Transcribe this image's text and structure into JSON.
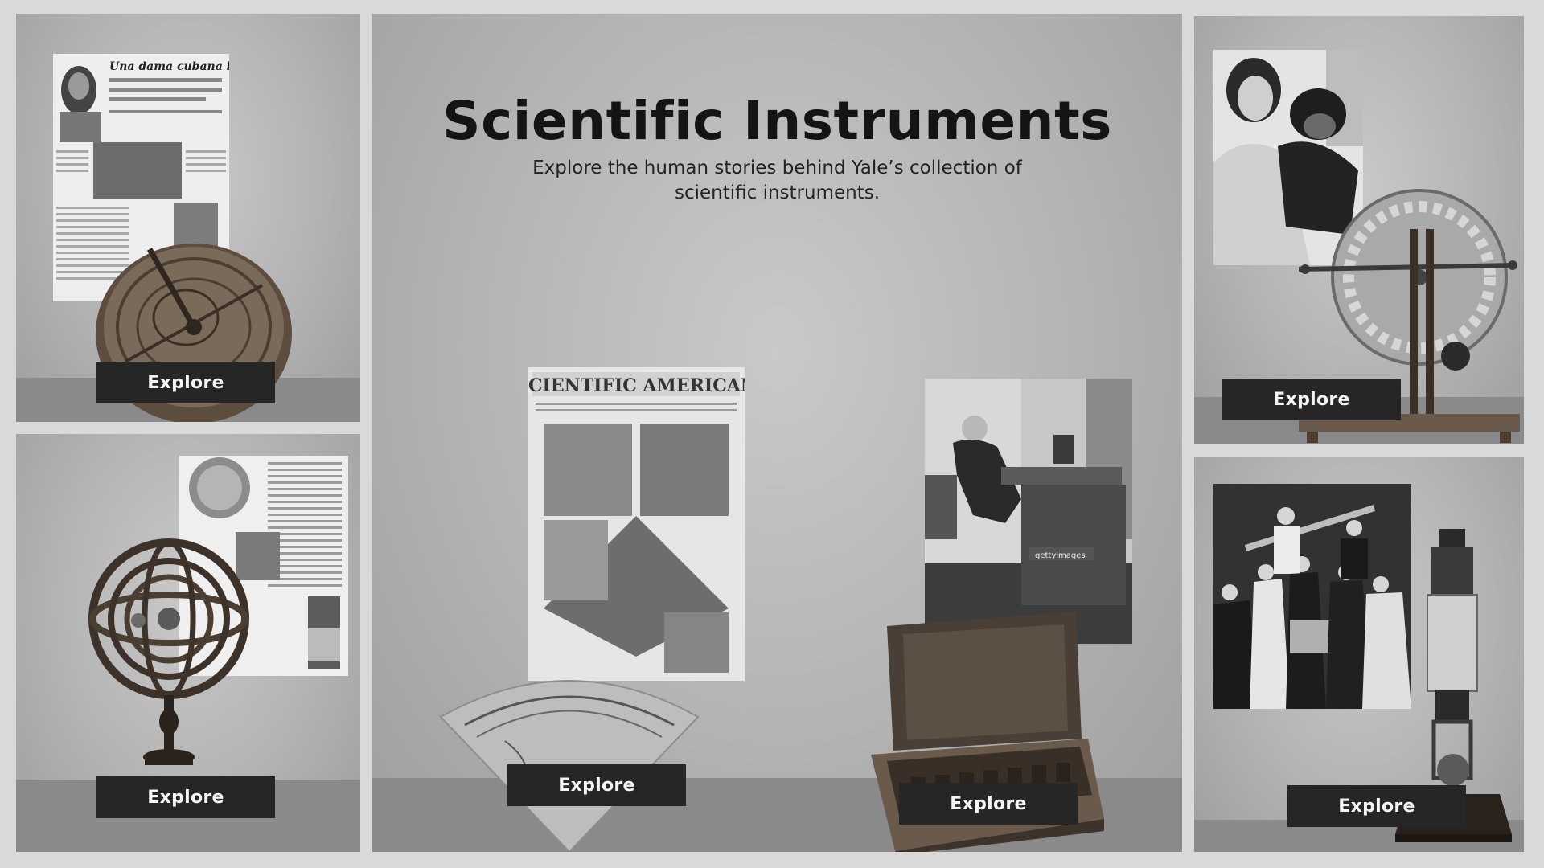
{
  "header": {
    "title": "Scientific Instruments",
    "subtitle": "Explore the human stories behind Yale’s collection of scientific instruments."
  },
  "cards": [
    {
      "id": "astrolabe",
      "button_label": "Explore",
      "image_text": "Una dama cubana lega, al morirse, varios millones para sus monos"
    },
    {
      "id": "armillary-sphere",
      "button_label": "Explore"
    },
    {
      "id": "scientific-american",
      "button_label": "Explore",
      "image_text": "SCIENTIFIC AMERICAN"
    },
    {
      "id": "instrument-case",
      "button_label": "Explore",
      "image_text": "gettyimages"
    },
    {
      "id": "wimshurst-machine",
      "button_label": "Explore"
    },
    {
      "id": "microscope",
      "button_label": "Explore"
    }
  ],
  "colors": {
    "page_background": "#d9d9d9",
    "panel_background": "#b5b5b5",
    "floor": "#8a8a8a",
    "button_background": "#262626",
    "button_text": "#f4f4f4",
    "title_text": "#141414"
  },
  "icons": [
    "astrolabe-image",
    "armillary-sphere-image",
    "quadrant-image",
    "wimshurst-machine-image",
    "microscope-image"
  ]
}
